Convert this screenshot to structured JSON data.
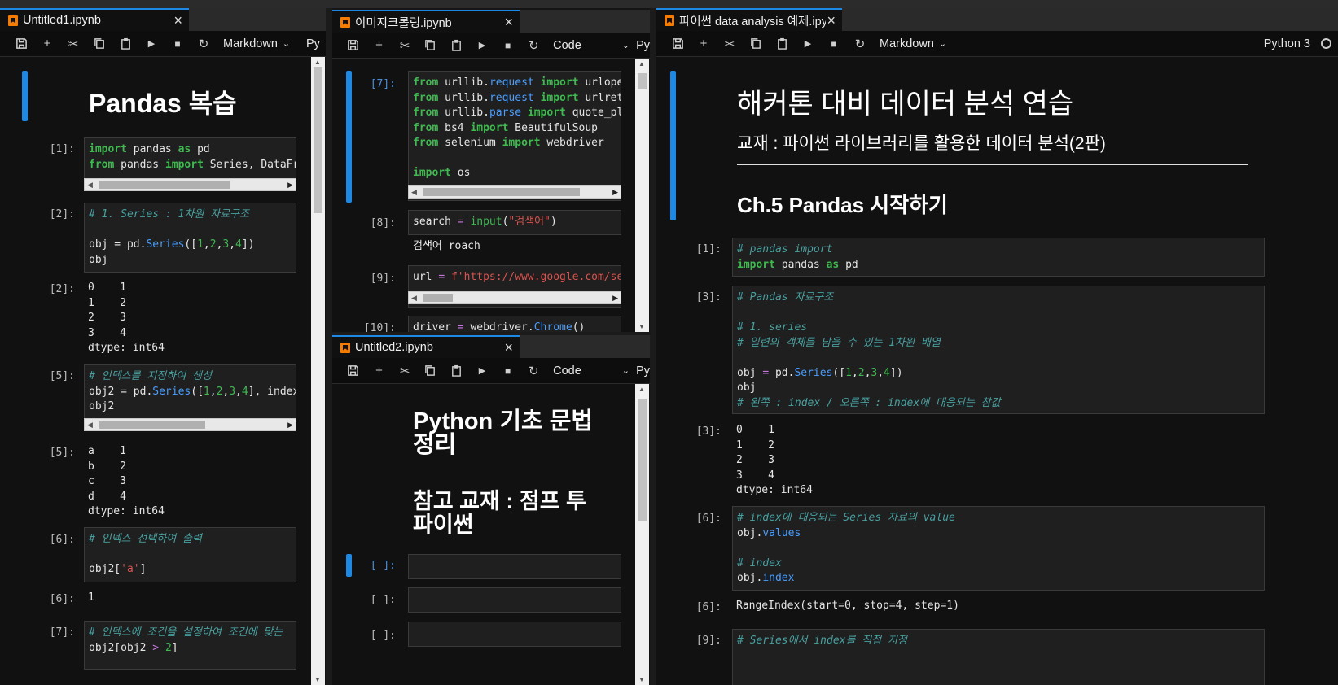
{
  "panels": {
    "p1": {
      "tab_title": "Untitled1.ipynb",
      "cell_type": "Markdown",
      "kernel": "Py",
      "heading": "Pandas 복습",
      "cells": [
        {
          "prompt": "[1]:"
        },
        {
          "prompt": "[2]:"
        },
        {
          "prompt": "[2]:"
        },
        {
          "prompt": "[5]:"
        },
        {
          "prompt": "[5]:"
        },
        {
          "prompt": "[6]:"
        },
        {
          "prompt": "[6]:",
          "output": "1"
        },
        {
          "prompt": "[7]:"
        }
      ],
      "output_2": "0    1\n1    2\n2    3\n3    4\ndtype: int64",
      "output_5": "a    1\nb    2\nc    3\nd    4\ndtype: int64"
    },
    "p2": {
      "tab_title": "이미지크롤링.ipynb",
      "cell_type": "Code",
      "kernel": "Py",
      "prompts": [
        "[7]:",
        "[8]:",
        "[9]:",
        "[10]:"
      ],
      "output_8": "검색어 roach"
    },
    "p3": {
      "tab_title": "Untitled2.ipynb",
      "cell_type": "Code",
      "kernel": "Py",
      "heading1": "Python 기초 문법 정리",
      "heading2": "참고 교재 : 점프 투 파이썬",
      "prompts": [
        "[ ]:",
        "[ ]:",
        "[ ]:"
      ]
    },
    "p4": {
      "tab_title": "파이썬 data analysis 예제.ipynb",
      "cell_type": "Markdown",
      "kernel": "Python 3",
      "heading1": "해커톤 대비 데이터 분석 연습",
      "heading2": "교재 : 파이썬 라이브러리를 활용한 데이터 분석(2판)",
      "heading3": "Ch.5 Pandas 시작하기",
      "prompts": [
        "[1]:",
        "[3]:",
        "[3]:",
        "[6]:",
        "[6]:",
        "[9]:"
      ],
      "output_3": "0    1\n1    2\n2    3\n3    4\ndtype: int64",
      "output_6": "RangeIndex(start=0, stop=4, step=1)"
    }
  },
  "icons": [
    "save-icon",
    "add-icon",
    "cut-icon",
    "copy-icon",
    "paste-icon",
    "run-icon",
    "stop-icon",
    "restart-icon"
  ],
  "colors": {
    "accent": "#1e88e5",
    "notebook_icon": "#f57c00",
    "keyword": "#3fb950",
    "comment": "#48a0a0",
    "string": "#d9534f"
  }
}
